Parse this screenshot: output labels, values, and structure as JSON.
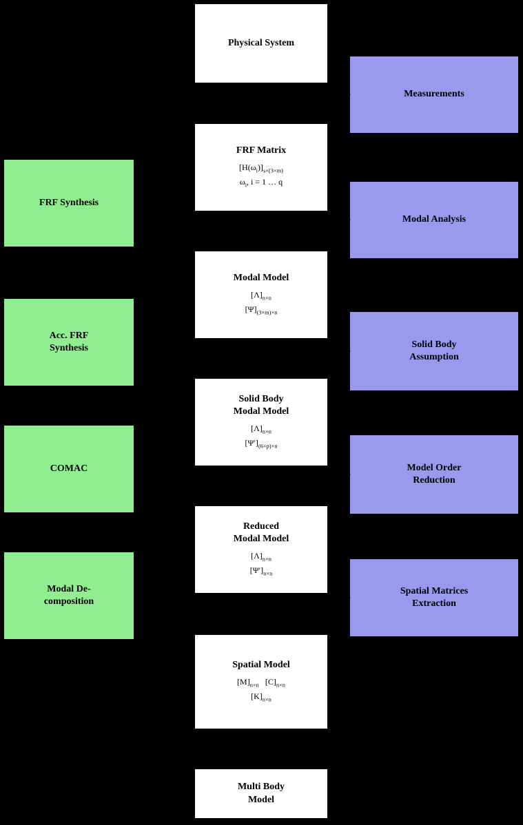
{
  "boxes": {
    "physical_system": {
      "title": "Physical System",
      "content": ""
    },
    "frf_matrix": {
      "title": "FRF Matrix",
      "line1": "[H(ω",
      "line2": "ω",
      "line2b": ", i = 1 … q"
    },
    "modal_model": {
      "title": "Modal Model",
      "line1": "[Λ]",
      "line2": "[Ψ]"
    },
    "solid_body_modal_model": {
      "title": "Solid Body Modal Model",
      "line1": "[Λ]",
      "line2": "[Ψ′]"
    },
    "reduced_modal_model": {
      "title": "Reduced Modal Model",
      "line1": "[Λ]",
      "line2": "[Ψ′]"
    },
    "spatial_model": {
      "title": "Spatial Model",
      "line1": "[M]",
      "line2": "[K]"
    },
    "multi_body_model": {
      "title": "Multi Body Model",
      "content": ""
    },
    "frf_synthesis": {
      "title": "FRF Synthesis"
    },
    "acc_frf_synthesis": {
      "title": "Acc. FRF Synthesis"
    },
    "comac": {
      "title": "COMAC"
    },
    "modal_decomposition": {
      "title": "Modal Decomposition"
    },
    "measurements": {
      "title": "Measurements"
    },
    "modal_analysis": {
      "title": "Modal Analysis"
    },
    "solid_body_assumption": {
      "title": "Solid Body Assumption"
    },
    "model_order_reduction": {
      "title": "Model Order Reduction"
    },
    "spatial_matrices_extraction": {
      "title": "Spatial Matrices Extraction"
    }
  }
}
